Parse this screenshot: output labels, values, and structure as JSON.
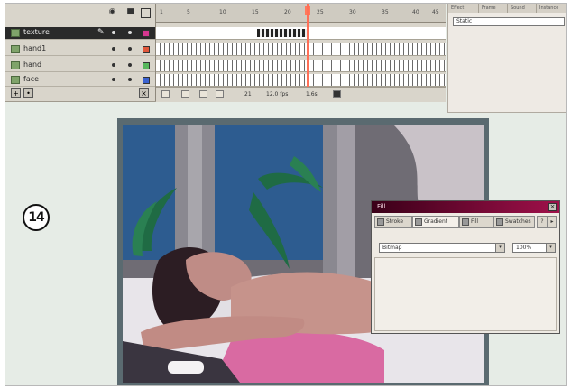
{
  "step_number": "14",
  "timeline": {
    "layers": [
      {
        "name": "texture",
        "selected": true,
        "color": "#d6378f"
      },
      {
        "name": "hand1",
        "selected": false,
        "color": "#e0573b"
      },
      {
        "name": "hand",
        "selected": false,
        "color": "#57b75b"
      },
      {
        "name": "face",
        "selected": false,
        "color": "#3b62d0"
      }
    ],
    "ruler_labels": [
      "1",
      "5",
      "10",
      "15",
      "20",
      "25",
      "30",
      "35",
      "40",
      "45"
    ],
    "status": {
      "frame": "21",
      "fps": "12.0 fps",
      "time": "1.6s"
    }
  },
  "right_panel": {
    "tabs": [
      "Effect",
      "Frame",
      "Sound",
      "Instance"
    ],
    "field_value": "Static"
  },
  "swatches_panel": {
    "title": "Fill",
    "tabs": [
      "Stroke",
      "Gradient",
      "Fill",
      "Swatches"
    ],
    "fill_type": "Bitmap",
    "alpha": "100%"
  },
  "colors": {
    "title_bar": "#a0104a",
    "playhead": "#ff6f57",
    "sky": "#2d5c90",
    "leaves": "#1f6b44",
    "pillow": "#d96aa2"
  }
}
